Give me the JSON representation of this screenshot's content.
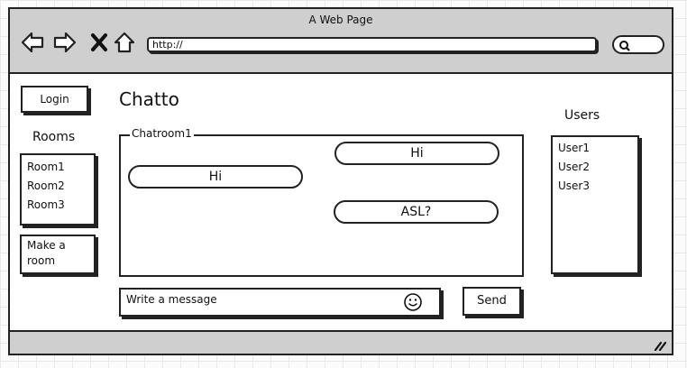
{
  "window": {
    "title": "A Web Page",
    "url": "http://",
    "nav": [
      "back-icon",
      "forward-icon",
      "close-icon",
      "home-icon"
    ],
    "search_icon": "search-icon"
  },
  "sidebar": {
    "login_label": "Login",
    "rooms_heading": "Rooms",
    "rooms": [
      {
        "label": "Room1"
      },
      {
        "label": "Room2"
      },
      {
        "label": "Room3"
      }
    ],
    "make_room_label": "Make a room"
  },
  "main": {
    "app_title": "Chatto",
    "chatroom_label": "Chatroom1",
    "messages": [
      {
        "text": "Hi"
      },
      {
        "text": "Hi"
      },
      {
        "text": "ASL?"
      }
    ],
    "composer": {
      "placeholder": "Write a message",
      "emoji_icon": "smiley-icon",
      "send_label": "Send"
    }
  },
  "users": {
    "heading": "Users",
    "list": [
      {
        "label": "User1"
      },
      {
        "label": "User2"
      },
      {
        "label": "User3"
      }
    ]
  }
}
